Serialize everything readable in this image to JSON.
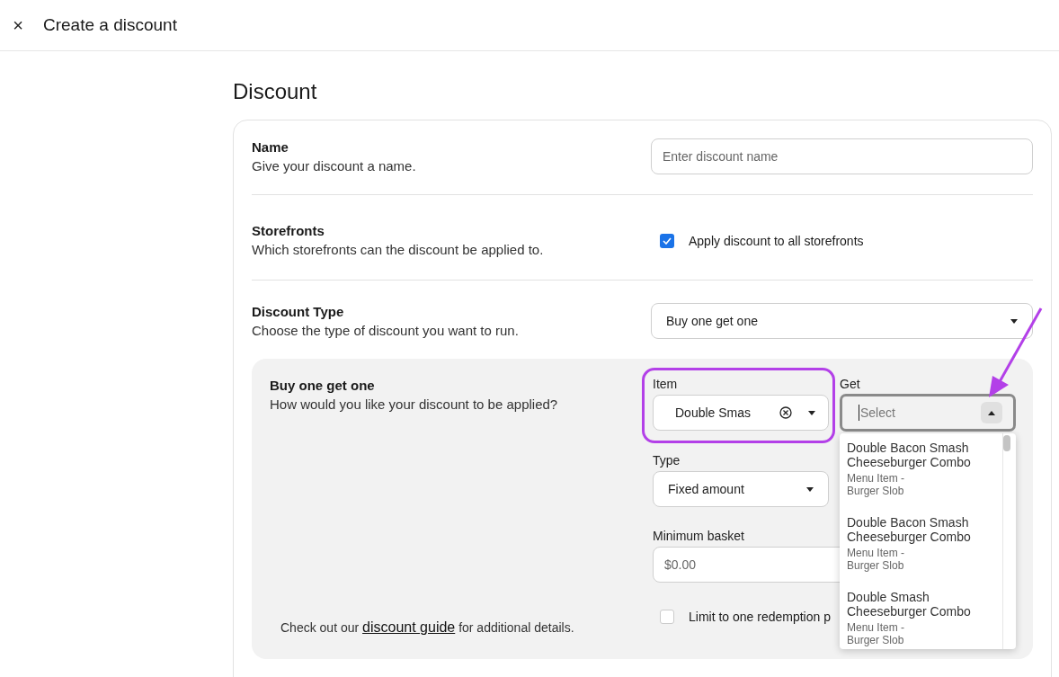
{
  "header": {
    "close": "×",
    "title": "Create a discount"
  },
  "heading": "Discount",
  "sections": [
    {
      "kind": "input",
      "title": "Name",
      "description": "Give your discount a name.",
      "placeholder": "Enter discount name"
    },
    {
      "kind": "checkbox",
      "title": "Storefronts",
      "description": "Which storefronts can the discount be applied to.",
      "label": "Apply discount to all storefronts",
      "checked": true
    },
    {
      "kind": "select",
      "title": "Discount Type",
      "description": "Choose the type of discount you want to run.",
      "value": "Buy one get one"
    }
  ],
  "bogo": {
    "title": "Buy one get one",
    "description": "How would you like your discount to be applied?",
    "guide": {
      "before": "Check out our",
      "link": "discount guide",
      "after": "for additional details."
    },
    "item": {
      "label": "Item",
      "value": "Double Smas"
    },
    "get": {
      "label": "Get",
      "placeholder": "Select",
      "expanded": true,
      "options": [
        {
          "title": "Double Bacon Smash Cheeseburger Combo",
          "subtitle": "Menu Item - Burger Slob"
        },
        {
          "title": "Double Bacon Smash Cheeseburger Combo",
          "subtitle": "Menu Item - Burger Slob"
        },
        {
          "title": "Double Smash Cheeseburger Combo",
          "subtitle": "Menu Item - Burger Slob"
        }
      ]
    },
    "type": {
      "label": "Type",
      "value": "Fixed amount"
    },
    "minimum_basket": {
      "label": "Minimum basket",
      "placeholder": "$0.00"
    },
    "limit": {
      "label": "Limit to one redemption p",
      "checked": false
    }
  }
}
